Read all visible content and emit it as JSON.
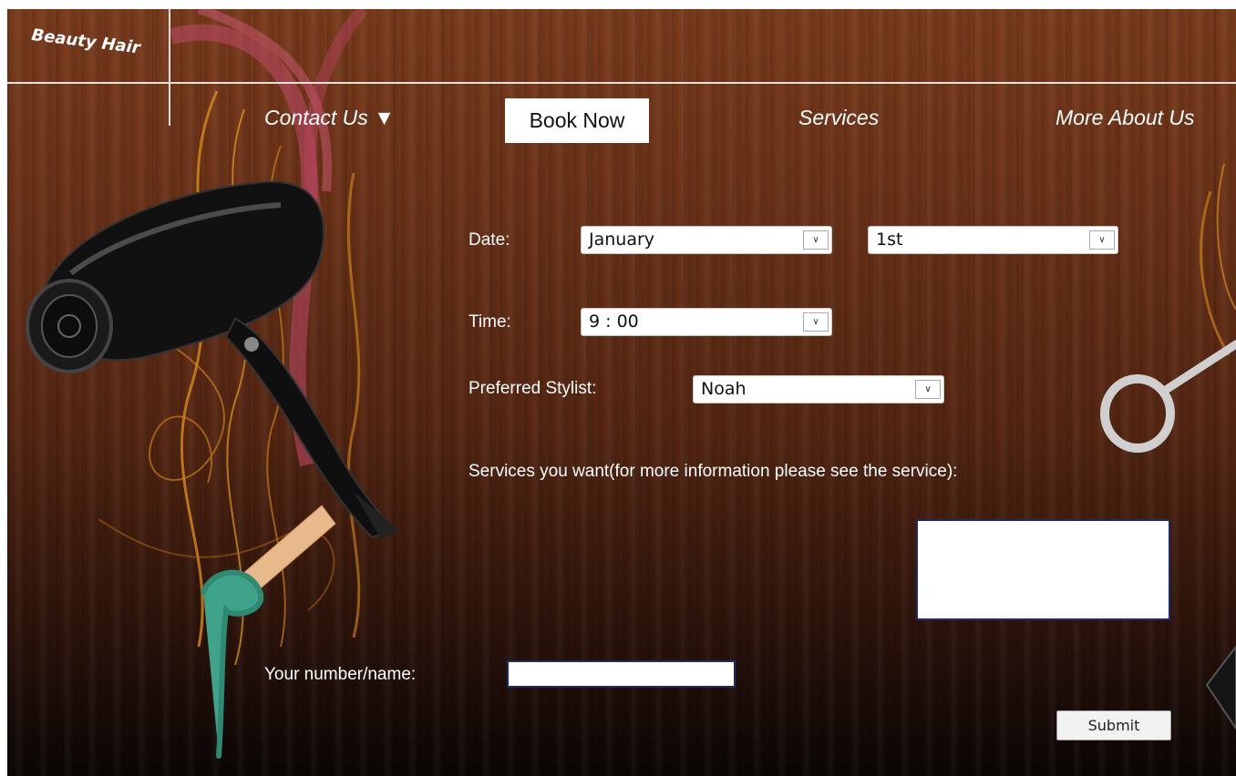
{
  "header": {
    "logo_text": "Beauty Hair",
    "nav": {
      "contact": "Contact Us ▼",
      "book": "Book Now",
      "services": "Services",
      "about": "More About Us"
    }
  },
  "form": {
    "date_label": "Date:",
    "month_value": "January",
    "day_value": "1st",
    "time_label": "Time:",
    "time_value": "9 : 00",
    "stylist_label": "Preferred Stylist:",
    "stylist_value": "Noah",
    "services_label": "Services you want(for more information please see the service):",
    "services_value": "",
    "name_label": "Your number/name:",
    "name_value": "",
    "submit_label": "Submit",
    "dropdown_arrow": "∨"
  },
  "icons": [
    "hair-dryer-icon",
    "scissors-icon",
    "wax-stick-icon",
    "swirl-decoration-icon",
    "chevron-down-icon"
  ],
  "colors": {
    "wood_dark": "#542612",
    "wood_light": "#7a3b1c",
    "swirl_pink": "#c04a6a",
    "swirl_gold": "#d98a1a",
    "input_border": "#1c2b6b"
  }
}
